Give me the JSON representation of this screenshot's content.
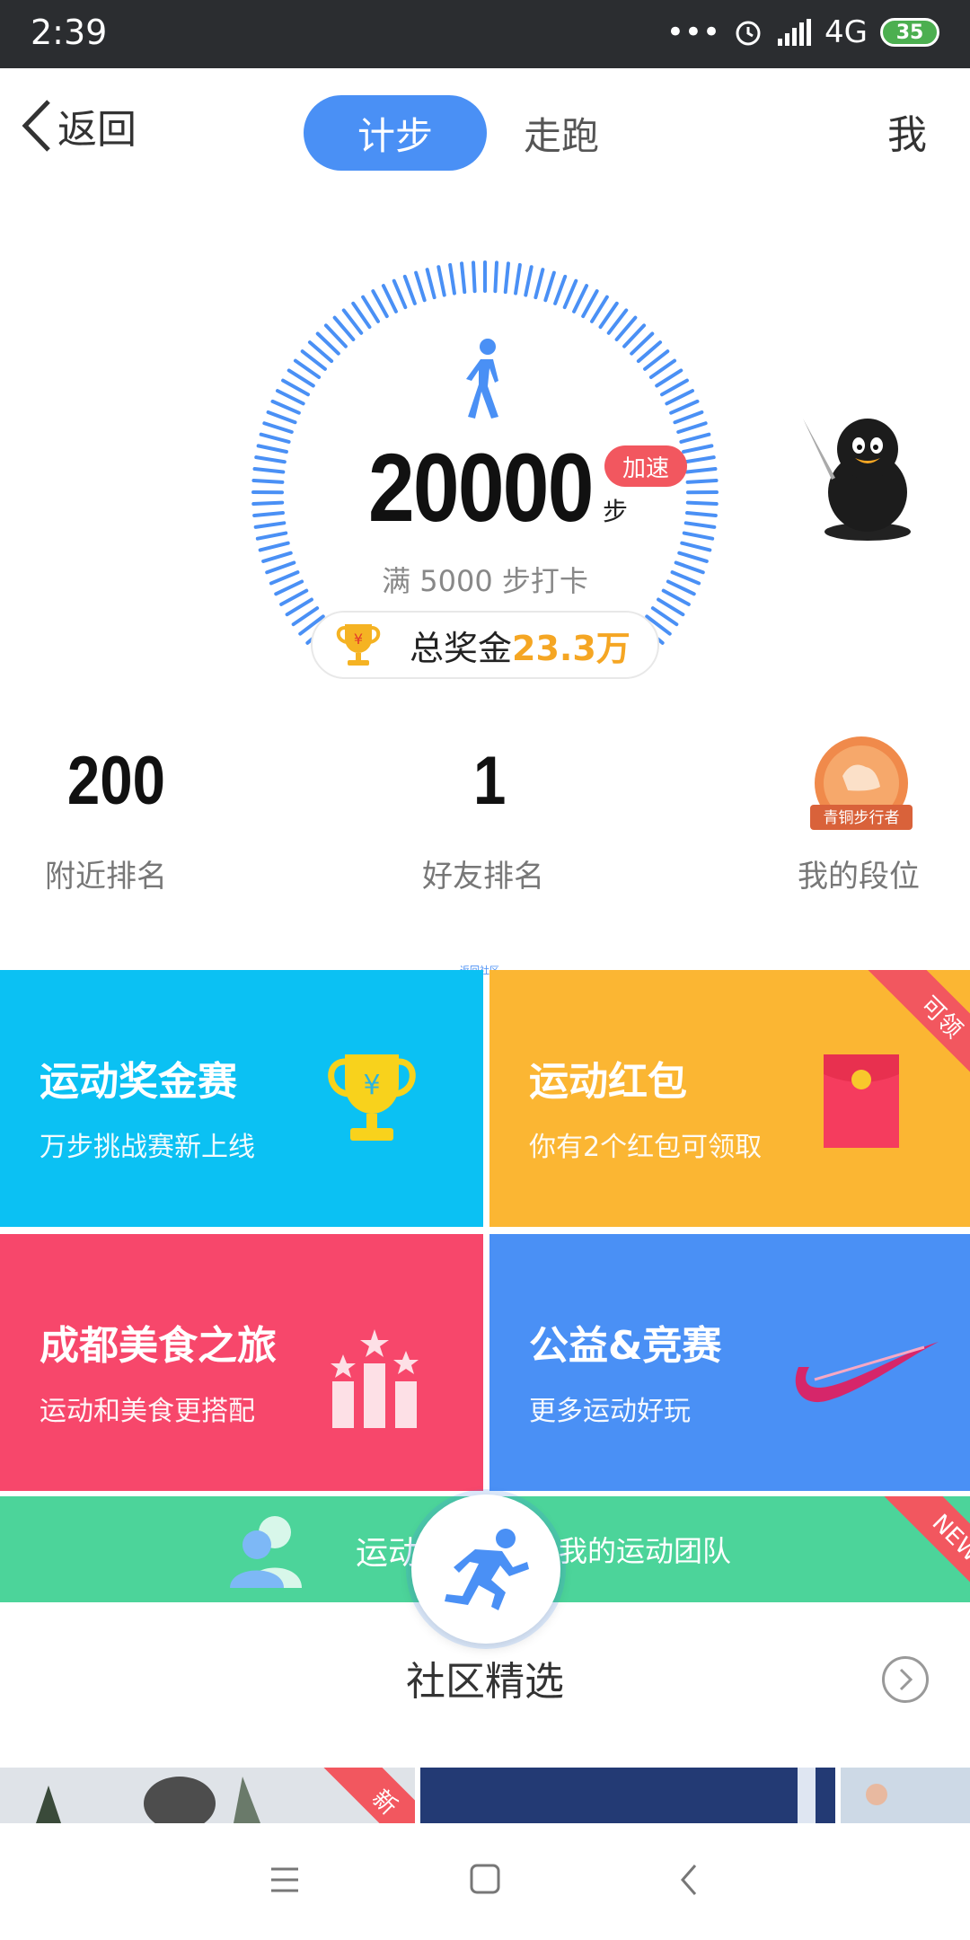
{
  "status_bar": {
    "time": "2:39",
    "dots": "•••",
    "network": "4G",
    "battery": "35"
  },
  "header": {
    "back_label": "返回",
    "tabs": [
      "计步",
      "走跑"
    ],
    "me_label": "我"
  },
  "pedometer": {
    "steps": "20000",
    "boost_label": "加速",
    "step_unit": "步",
    "goal_text": "满 5000 步打卡",
    "prize_label": "总奖金",
    "prize_value": "23.3万"
  },
  "rankings": [
    {
      "value": "200",
      "label": "附近排名"
    },
    {
      "value": "1",
      "label": "好友排名"
    },
    {
      "label": "我的段位",
      "badge_text": "青铜步行者"
    }
  ],
  "tiny_link": "返回社区",
  "tiles": [
    {
      "title": "运动奖金赛",
      "subtitle": "万步挑战赛新上线",
      "color": "#0bc1f3"
    },
    {
      "title": "运动红包",
      "subtitle": "你有2个红包可领取",
      "ribbon": "可领",
      "color": "#fbb633"
    },
    {
      "title": "成都美食之旅",
      "subtitle": "运动和美食更搭配",
      "color": "#f7476b"
    },
    {
      "title": "公益&竞赛",
      "subtitle": "更多运动好玩",
      "color": "#4a90f5"
    }
  ],
  "team": {
    "text_left": "运动",
    "text_right": "我的运动团队",
    "ribbon": "NEW",
    "color": "#4cd49a"
  },
  "community": {
    "title": "社区精选",
    "thumb_ribbon": "新"
  },
  "colors": {
    "accent": "#4a90f5",
    "prize": "#f5a623",
    "ribbon_red": "#f2575f"
  }
}
